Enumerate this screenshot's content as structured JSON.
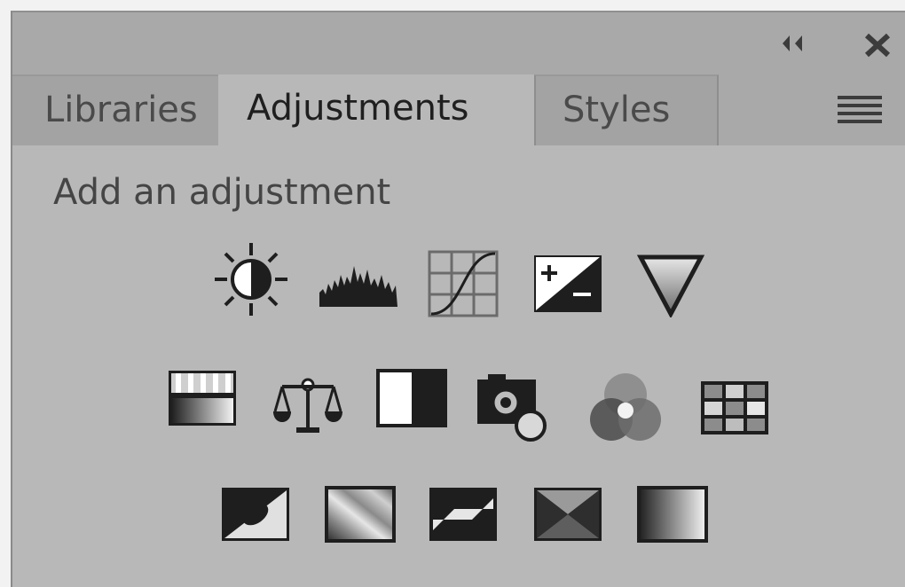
{
  "panel": {
    "tabs": [
      {
        "label": "Libraries"
      },
      {
        "label": "Adjustments"
      },
      {
        "label": "Styles"
      }
    ],
    "active_tab": "Adjustments",
    "heading": "Add an adjustment"
  },
  "adjustments": {
    "rows": [
      [
        {
          "name": "Brightness/Contrast",
          "icon": "brightness-contrast-icon"
        },
        {
          "name": "Levels",
          "icon": "levels-icon"
        },
        {
          "name": "Curves",
          "icon": "curves-icon"
        },
        {
          "name": "Exposure",
          "icon": "exposure-icon"
        },
        {
          "name": "Vibrance",
          "icon": "vibrance-icon"
        }
      ],
      [
        {
          "name": "Hue/Saturation",
          "icon": "hue-saturation-icon"
        },
        {
          "name": "Color Balance",
          "icon": "color-balance-icon"
        },
        {
          "name": "Black & White",
          "icon": "black-white-icon"
        },
        {
          "name": "Photo Filter",
          "icon": "photo-filter-icon"
        },
        {
          "name": "Channel Mixer",
          "icon": "channel-mixer-icon"
        },
        {
          "name": "Color Lookup",
          "icon": "color-lookup-icon"
        }
      ],
      [
        {
          "name": "Invert",
          "icon": "invert-icon"
        },
        {
          "name": "Posterize",
          "icon": "posterize-icon"
        },
        {
          "name": "Threshold",
          "icon": "threshold-icon"
        },
        {
          "name": "Selective Color",
          "icon": "selective-color-icon"
        },
        {
          "name": "Gradient Map",
          "icon": "gradient-map-icon"
        }
      ]
    ]
  },
  "colors": {
    "panel_bg": "#b8b8b8",
    "tab_bar_bg": "#a9a9a9",
    "icon_dark": "#1e1e1e"
  }
}
